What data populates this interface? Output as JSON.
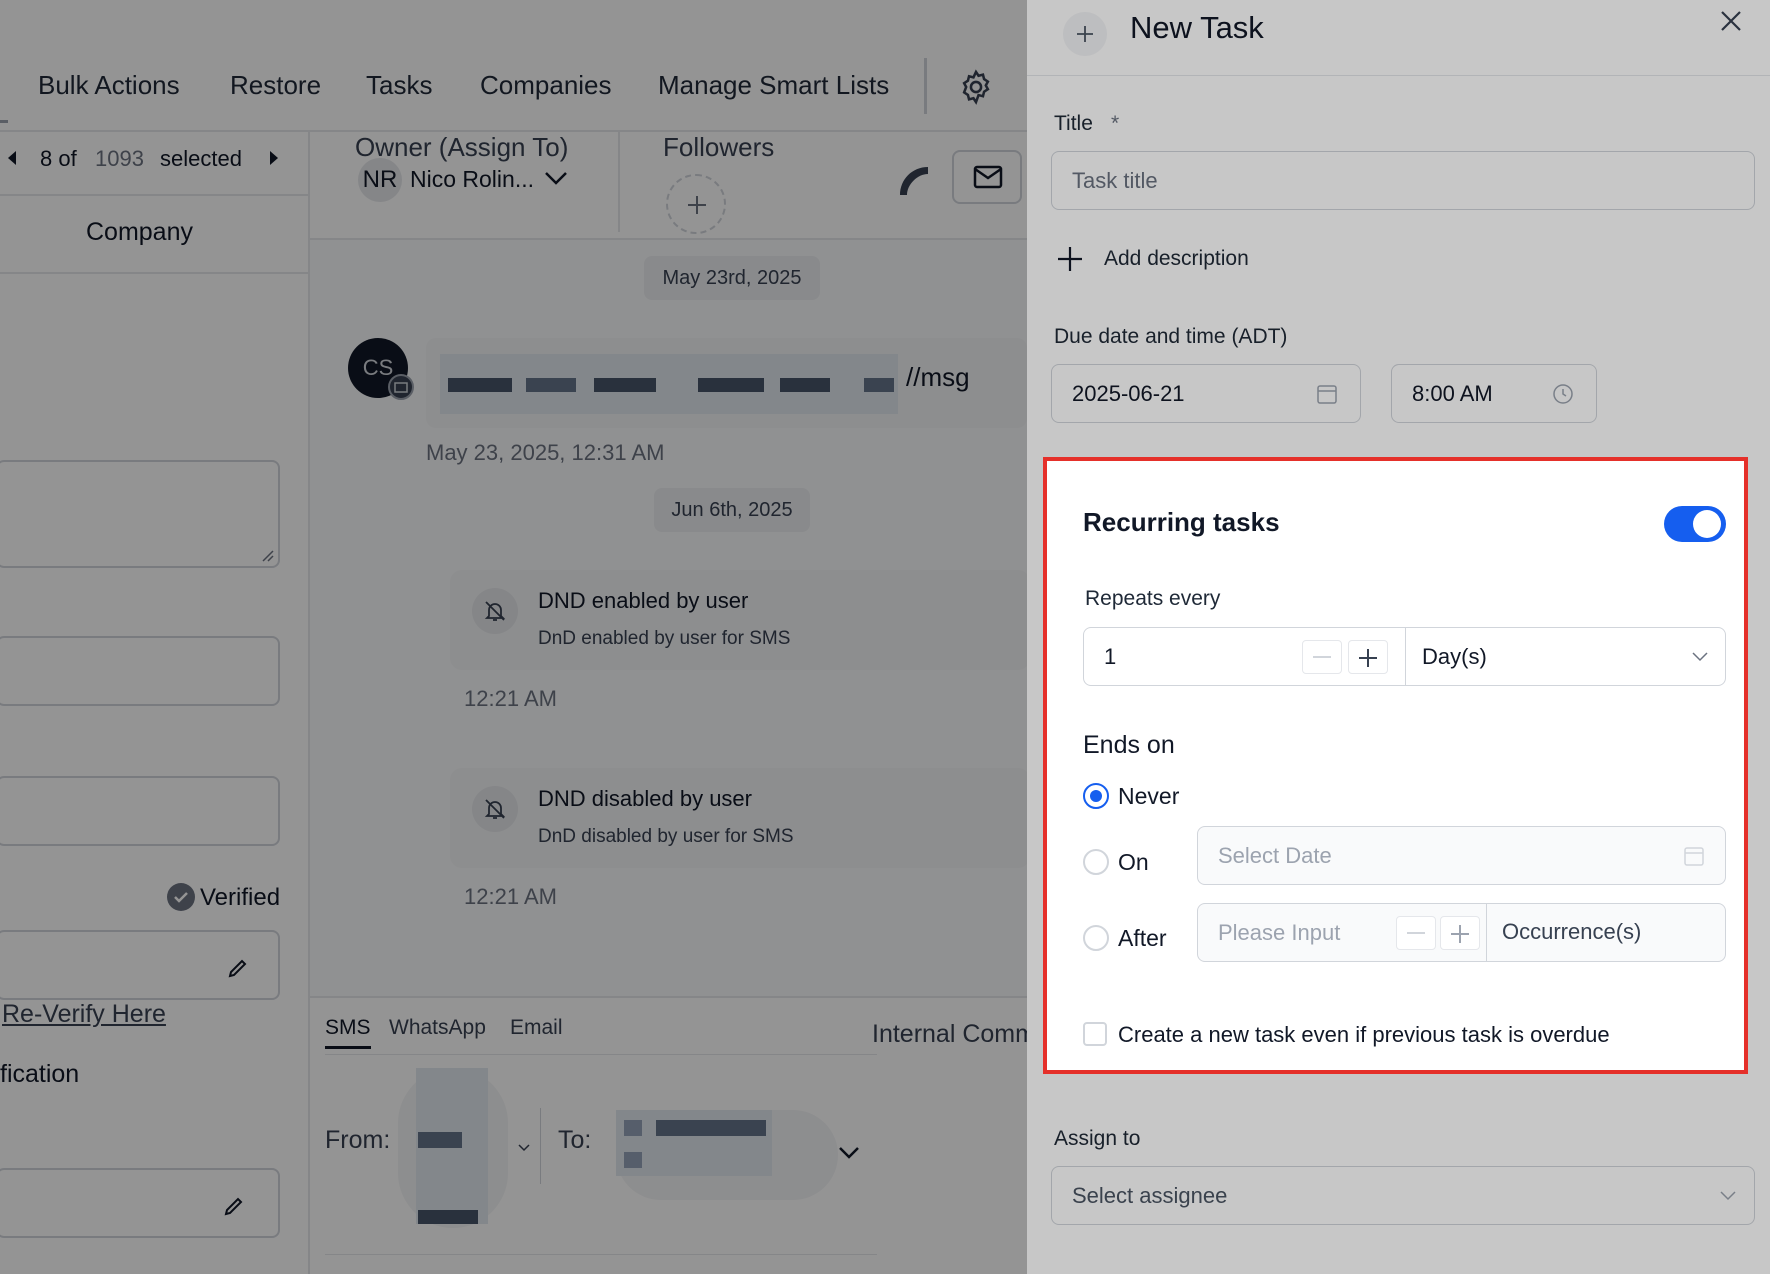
{
  "nav": {
    "items": [
      "Bulk Actions",
      "Restore",
      "Tasks",
      "Companies",
      "Manage Smart Lists"
    ]
  },
  "record_nav": {
    "current": "8 of",
    "total": "1093",
    "suffix": "selected"
  },
  "left": {
    "section_title": "Company",
    "verified_label": "Verified",
    "reverify_link": "Re-Verify Here",
    "partial_label": "fication"
  },
  "header": {
    "owner_label": "Owner (Assign To)",
    "owner_initials": "NR",
    "owner_name": "Nico Rolin...",
    "followers_label": "Followers"
  },
  "chat": {
    "date1": "May 23rd, 2025",
    "avatar_initials": "CS",
    "msg_fragment": "//msg",
    "msg_time": "May 23, 2025, 12:31 AM",
    "date2": "Jun 6th, 2025",
    "events": [
      {
        "title": "DND enabled by user",
        "sub": "DnD enabled by user for SMS",
        "time": "12:21 AM"
      },
      {
        "title": "DND disabled by user",
        "sub": "DnD disabled by user for SMS",
        "time": "12:21 AM"
      }
    ]
  },
  "composer": {
    "tabs": [
      "SMS",
      "WhatsApp",
      "Email"
    ],
    "internal": "Internal Comm",
    "from_label": "From:",
    "to_label": "To:"
  },
  "panel": {
    "title": "New Task",
    "title_label": "Title",
    "required_mark": "*",
    "title_placeholder": "Task title",
    "add_description": "Add description",
    "due_label": "Due date and time (ADT)",
    "due_date": "2025-06-21",
    "due_time": "8:00 AM",
    "recurring": {
      "heading": "Recurring tasks",
      "enabled": true,
      "repeats_label": "Repeats every",
      "repeat_value": "1",
      "unit": "Day(s)",
      "ends_label": "Ends on",
      "options": [
        "Never",
        "On",
        "After"
      ],
      "selected": "Never",
      "select_date_placeholder": "Select Date",
      "please_input_placeholder": "Please Input",
      "occurrences": "Occurrence(s)",
      "overdue_checkbox": "Create a new task even if previous task is overdue"
    },
    "assign_label": "Assign to",
    "assign_placeholder": "Select assignee"
  },
  "colors": {
    "accent": "#155eef",
    "highlight": "#e5302a"
  }
}
